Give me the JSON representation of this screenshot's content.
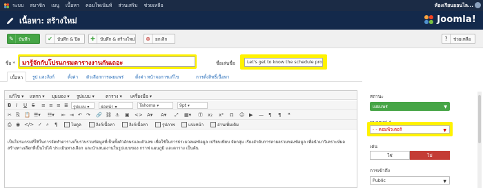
{
  "topnav": {
    "items": [
      "ระบบ",
      "สมาชิก",
      "เมนู",
      "เนื้อหา",
      "คอมโพเน้นท์",
      "ส่วนเสริม",
      "ช่วยเหลือ"
    ],
    "site_link": "ห้องเรียนออนไล..."
  },
  "header": {
    "title": "เนื้อหา: สร้างใหม่",
    "logo_text": "Joomla!"
  },
  "toolbar": {
    "save": "บันทึก",
    "save_close": "บันทึก & ปิด",
    "save_new": "บันทึก & สร้างใหม่",
    "cancel": "ยกเลิก",
    "help": "ช่วยเหลือ"
  },
  "form": {
    "title_label": "ชื่อ *",
    "title_value": "มารู้จักกับโปรแกรมตารางงานกันเถอะ",
    "alias_label": "ชื่อเล่นชื่อ",
    "alias_value": "Let's get to know the schedule prog"
  },
  "tabs": [
    "เนื้อหา",
    "รูป และลิงก์",
    "ตั้งค่า",
    "ตัวเลือกการเผยแพร่",
    "ตั้งค่า หน้าจอการแก้ไข",
    "การตั้งสิทธิ์เนื้อหา"
  ],
  "editor": {
    "menus": [
      "แก้ไข",
      "แทรก",
      "มุมมอง",
      "รูปแบบ",
      "ตาราง",
      "เครื่องมือ"
    ],
    "format_select": "รูปแบบ",
    "paragraph_select": "ย่อหน้า",
    "font_select": "Tahoma",
    "size_select": "9pt",
    "insert_buttons": [
      "โมดูล",
      "ลิงก์เนื้อหา",
      "ลิงก์เนื้อหา",
      "รูปภาพ",
      "แบ่งหน้า",
      "อ่านเพิ่มเติม"
    ],
    "body_text": "เป็นโปรแกรมที่ใช้ในการจัดทำตารางเก็บรวบรวมข้อมูลที่เป็นทั้งตัวอักษรและตัวเลข เพื่อใช้ในการประมวลผลข้อมูล เปรียบเทียบ จัดกลุ่ม เรียงลำดับการหาผลรวมของข้อมูล เพื่อนำมาวิเคราะห์ผล สร้างทางเลือกที่เป็นไปได้ ประเมินทางเลือก และนำเสนองานในรูปแบบของ กราฟ แผนภูมิ และตาราง เป็นต้น"
  },
  "sidebar": {
    "status_label": "สถานะ",
    "status_value": "เผยแพร่",
    "category_label": "หมวดหมู่ *",
    "category_value": "- - คอมพิวเตอร์",
    "featured_label": "เด่น",
    "featured_yes": "ใช่",
    "featured_no": "ไม่",
    "access_label": "การเข้าถึง",
    "access_value": "Public"
  },
  "colors": {
    "nav": "#1b2b45",
    "header": "#13294b",
    "green": "#46a546",
    "red": "#c43c35",
    "highlight": "#fff200"
  }
}
